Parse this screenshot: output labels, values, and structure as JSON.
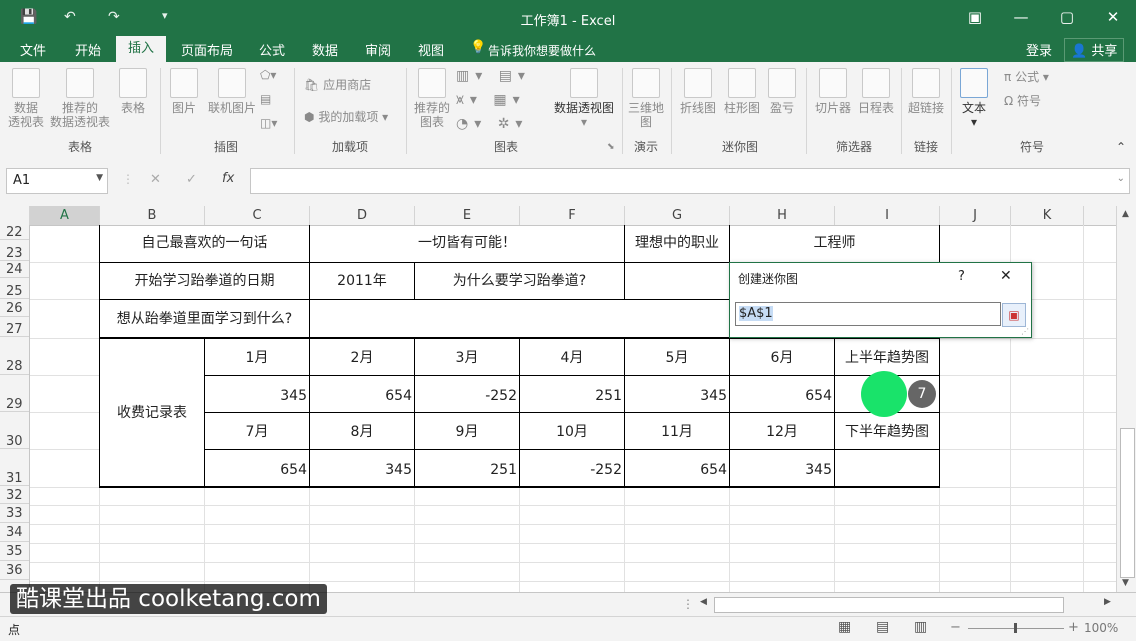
{
  "window": {
    "title": "工作簿1 - Excel",
    "min": "—",
    "restore": "▢",
    "close": "✕",
    "ribbon_opts": "▣"
  },
  "qat": {
    "save": "💾",
    "undo": "↶",
    "redo": "↷",
    "more": "▾"
  },
  "tabs": {
    "file": "文件",
    "home": "开始",
    "insert": "插入",
    "layout": "页面布局",
    "formulas": "公式",
    "data": "数据",
    "review": "审阅",
    "view": "视图",
    "tell": "告诉我你想要做什么",
    "login": "登录",
    "share": "共享"
  },
  "ribbon": {
    "pivot": [
      "数据",
      "透视表"
    ],
    "rec_pivot": [
      "推荐的",
      "数据透视表"
    ],
    "table": "表格",
    "picture": "图片",
    "online_pic": "联机图片",
    "store": "应用商店",
    "my_addins": "我的加载项",
    "rec_charts": [
      "推荐的",
      "图表"
    ],
    "pivot_chart": "数据透视图",
    "map3d": [
      "三维地",
      "图"
    ],
    "line": "折线图",
    "column": "柱形图",
    "winloss": "盈亏",
    "slicer": "切片器",
    "timeline": "日程表",
    "hyperlink": "超链接",
    "text": "文本",
    "equation": "公式",
    "symbol": "符号",
    "groups": {
      "tables": "表格",
      "illus": "插图",
      "addins": "加载项",
      "charts": "图表",
      "tours": "演示",
      "spark": "迷你图",
      "filters": "筛选器",
      "links": "链接",
      "symbols": "符号"
    }
  },
  "formula_bar": {
    "namebox": "A1",
    "cancel": "✕",
    "enter": "✓",
    "fx": "fx",
    "value": ""
  },
  "columns": [
    "A",
    "B",
    "C",
    "D",
    "E",
    "F",
    "G",
    "H",
    "I",
    "J",
    "K"
  ],
  "rows": [
    "22",
    "23",
    "24",
    "25",
    "26",
    "27",
    "28",
    "29",
    "30",
    "31",
    "32",
    "33",
    "34",
    "35",
    "36"
  ],
  "sheet": {
    "fav_sentence_label": "自己最喜欢的一句话",
    "fav_sentence": "一切皆有可能！",
    "job_label": "理想中的职业",
    "job": "工程师",
    "start_label": "开始学习跆拳道的日期",
    "start_year": "2011年",
    "why_label": "为什么要学习跆拳道?",
    "learn_label": "想从跆拳道里面学习到什么?",
    "fee_label": "收费记录表",
    "months1": [
      "1月",
      "2月",
      "3月",
      "4月",
      "5月",
      "6月"
    ],
    "vals1": [
      "345",
      "654",
      "-252",
      "251",
      "345",
      "654"
    ],
    "trend1": "上半年趋势图",
    "months2": [
      "7月",
      "8月",
      "9月",
      "10月",
      "11月",
      "12月"
    ],
    "vals2": [
      "654",
      "345",
      "251",
      "-252",
      "654",
      "345"
    ],
    "trend2": "下半年趋势图"
  },
  "dialog": {
    "title": "创建迷你图",
    "help": "?",
    "close": "✕",
    "value": "$A$1"
  },
  "step_badge": "7",
  "watermark": "酷课堂出品 coolketang.com",
  "status": {
    "mode": "点",
    "zoom": "100%"
  }
}
